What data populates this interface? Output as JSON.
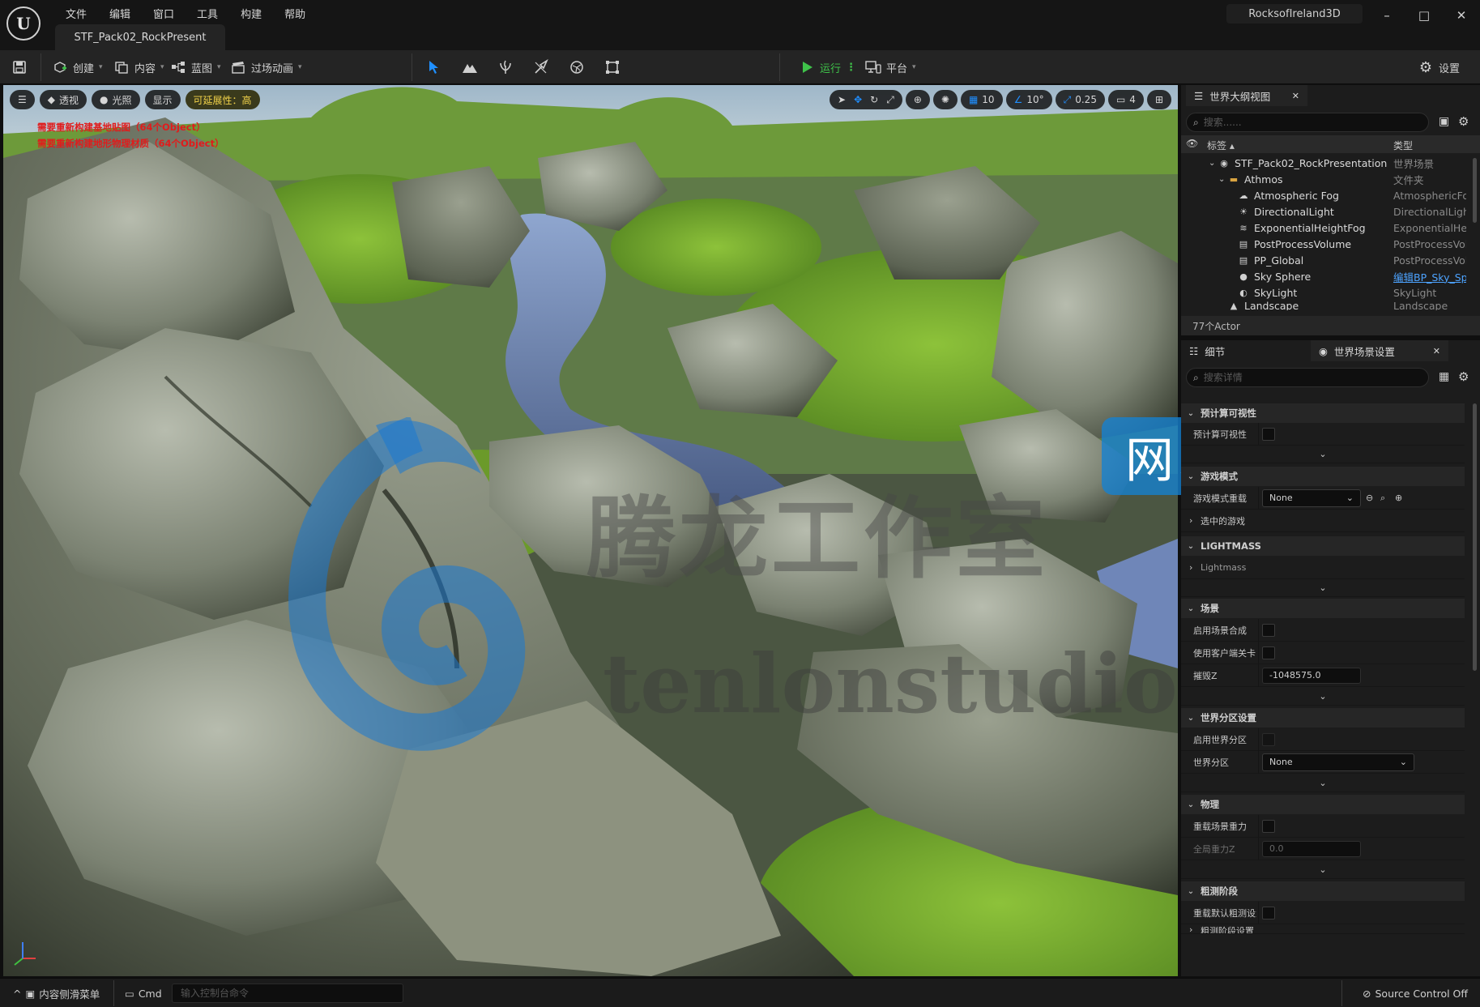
{
  "app": {
    "logo_text": "U",
    "menu": [
      "文件",
      "编辑",
      "窗口",
      "工具",
      "构建",
      "帮助"
    ],
    "document_tab": "STF_Pack02_RockPresent",
    "project_name": "RocksofIreland3D"
  },
  "toolbar": {
    "create": "创建",
    "content": "内容",
    "blueprint": "蓝图",
    "cinematics": "过场动画",
    "play": "运行",
    "platform": "平台",
    "settings": "设置"
  },
  "viewport": {
    "perspective": "透视",
    "lit": "光照",
    "show": "显示",
    "scalability": "可延展性：高",
    "grid_snap": "10",
    "rotation_snap": "10°",
    "scale_snap": "0.25",
    "camera_speed": "4",
    "warning_1": "需要重新构建基地贴图（64个Object）",
    "warning_2": "需要重新构建地形物理材质（64个Object）"
  },
  "outliner": {
    "tab": "世界大纲视图",
    "search_placeholder": "搜索......",
    "col_label": "标签",
    "col_type": "类型",
    "items": [
      {
        "name": "STF_Pack02_RockPresentation",
        "type": "世界场景"
      },
      {
        "name": "Athmos",
        "type": "文件夹"
      },
      {
        "name": "Atmospheric Fog",
        "type": "AtmosphericFog"
      },
      {
        "name": "DirectionalLight",
        "type": "DirectionalLight"
      },
      {
        "name": "ExponentialHeightFog",
        "type": "ExponentialHeightFog"
      },
      {
        "name": "PostProcessVolume",
        "type": "PostProcessVolume"
      },
      {
        "name": "PP_Global",
        "type": "PostProcessVolume"
      },
      {
        "name": "Sky Sphere",
        "type": "编辑BP_Sky_Sphere"
      },
      {
        "name": "SkyLight",
        "type": "SkyLight"
      },
      {
        "name": "Landscape",
        "type": "Landscape"
      }
    ],
    "actor_count": "77个Actor"
  },
  "details": {
    "tab_details": "细节",
    "tab_world": "世界场景设置",
    "search_placeholder": "搜索详情",
    "sections": {
      "precomputed": "预计算可视性",
      "precomputed_row": "预计算可视性",
      "game_mode": "游戏模式",
      "game_mode_override": "游戏模式重载",
      "game_mode_value": "None",
      "selected_game": "选中的游戏",
      "lightmass": "LIGHTMASS",
      "lightmass_row": "Lightmass",
      "world": "场景",
      "enable_world_composition": "启用场景合成",
      "use_client_side": "使用客户端关卡",
      "kill_z": "摧毁Z",
      "kill_z_value": "-1048575.0",
      "world_partition": "世界分区设置",
      "enable_partition": "启用世界分区",
      "partition": "世界分区",
      "partition_value": "None",
      "physics": "物理",
      "override_gravity": "重载场景重力",
      "global_gravity": "全局重力Z",
      "global_gravity_value": "0.0",
      "broadphase": "粗测阶段",
      "override_broadphase": "重载默认粗测设置",
      "broadphase_settings": "粗测阶段设置"
    }
  },
  "statusbar": {
    "content_drawer": "内容侧滑菜单",
    "cmd": "Cmd",
    "console_placeholder": "输入控制台命令",
    "source_control": "Source Control Off"
  },
  "watermark": {
    "title": "腾龙工作室",
    "url": "tenlonstudio.com",
    "badge": "网站"
  }
}
